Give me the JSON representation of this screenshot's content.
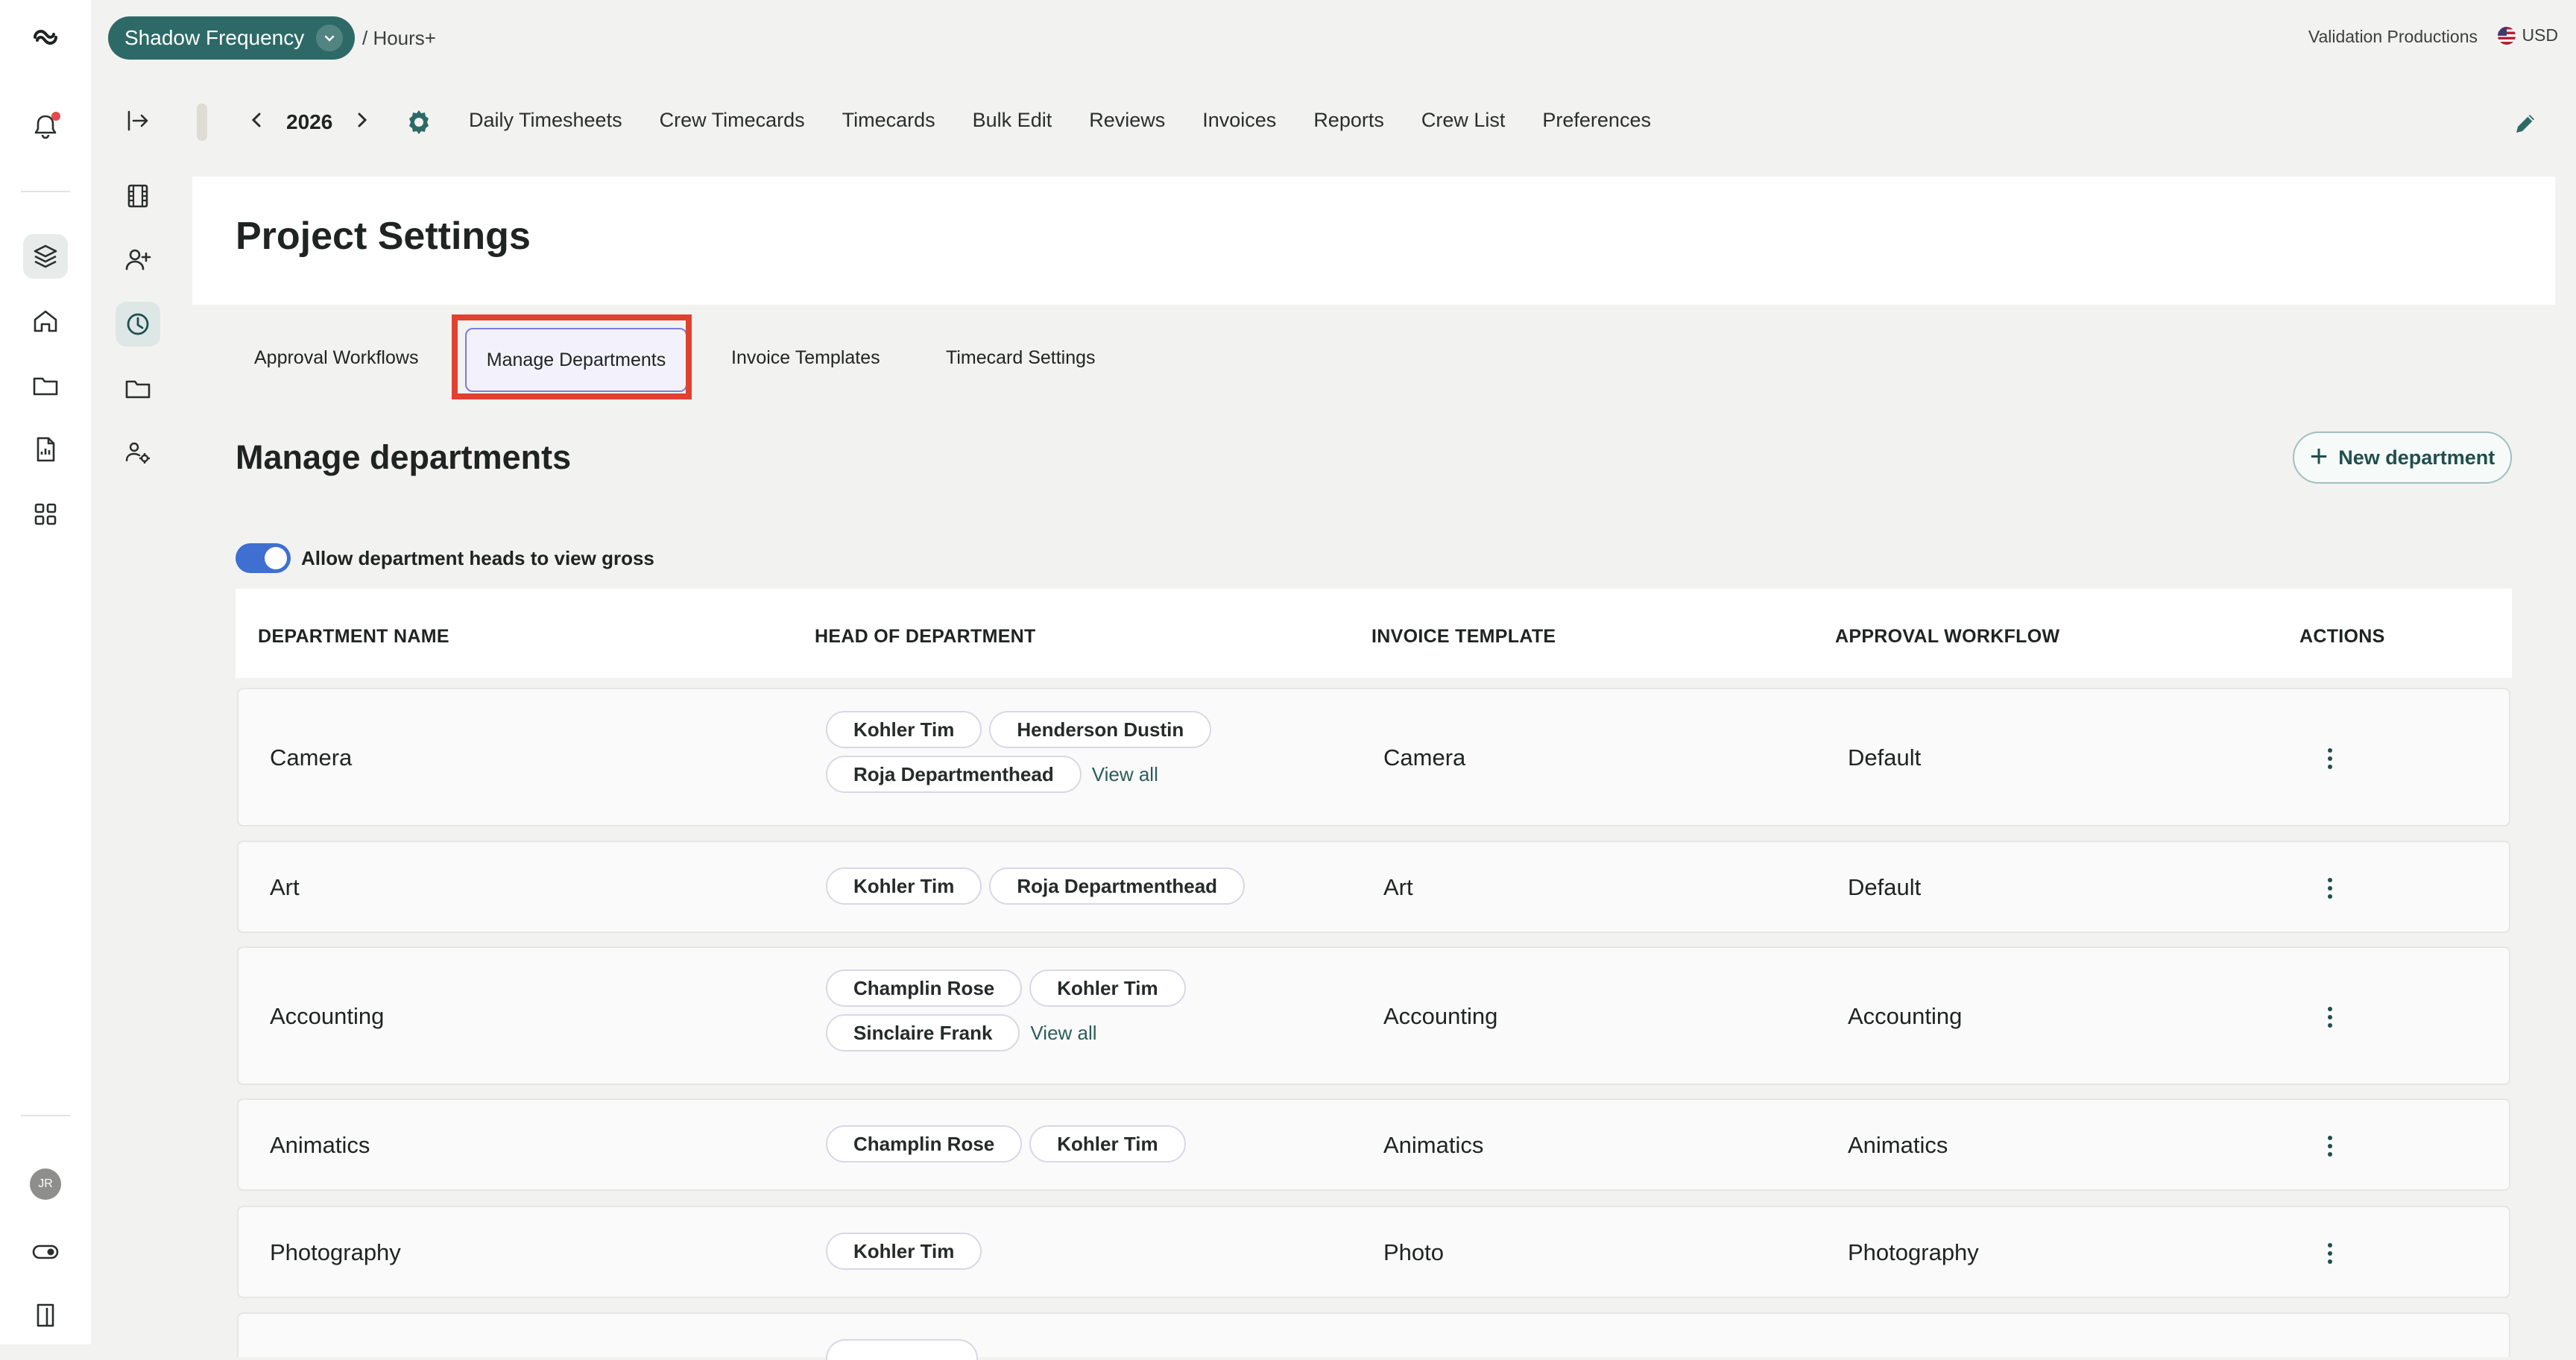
{
  "topbar": {
    "project_name": "Shadow Frequency",
    "breadcrumb": "/ Hours+",
    "company": "Validation Productions",
    "currency": "USD"
  },
  "navbar": {
    "year": "2026",
    "items": [
      "Daily Timesheets",
      "Crew Timecards",
      "Timecards",
      "Bulk Edit",
      "Reviews",
      "Invoices",
      "Reports",
      "Crew List",
      "Preferences"
    ]
  },
  "page": {
    "title": "Project Settings",
    "tabs": [
      "Approval Workflows",
      "Manage Departments",
      "Invoice Templates",
      "Timecard Settings"
    ],
    "active_tab": "Manage Departments"
  },
  "section": {
    "title": "Manage departments",
    "new_button": "New department",
    "toggle_label": "Allow department heads to view gross",
    "toggle_on": true
  },
  "table": {
    "headers": [
      "DEPARTMENT NAME",
      "HEAD OF DEPARTMENT",
      "INVOICE TEMPLATE",
      "APPROVAL WORKFLOW",
      "ACTIONS"
    ],
    "view_all": "View all",
    "rows": [
      {
        "name": "Camera",
        "heads": [
          "Kohler Tim",
          "Henderson Dustin",
          "Roja Departmenthead"
        ],
        "view_all": true,
        "invoice": "Camera",
        "workflow": "Default"
      },
      {
        "name": "Art",
        "heads": [
          "Kohler Tim",
          "Roja Departmenthead"
        ],
        "view_all": false,
        "invoice": "Art",
        "workflow": "Default"
      },
      {
        "name": "Accounting",
        "heads": [
          "Champlin Rose",
          "Kohler Tim",
          "Sinclaire Frank"
        ],
        "view_all": true,
        "invoice": "Accounting",
        "workflow": "Accounting"
      },
      {
        "name": "Animatics",
        "heads": [
          "Champlin Rose",
          "Kohler Tim"
        ],
        "view_all": false,
        "invoice": "Animatics",
        "workflow": "Animatics"
      },
      {
        "name": "Photography",
        "heads": [
          "Kohler Tim"
        ],
        "view_all": false,
        "invoice": "Photo",
        "workflow": "Photography"
      }
    ]
  },
  "rail": {
    "avatar_initials": "JR"
  }
}
